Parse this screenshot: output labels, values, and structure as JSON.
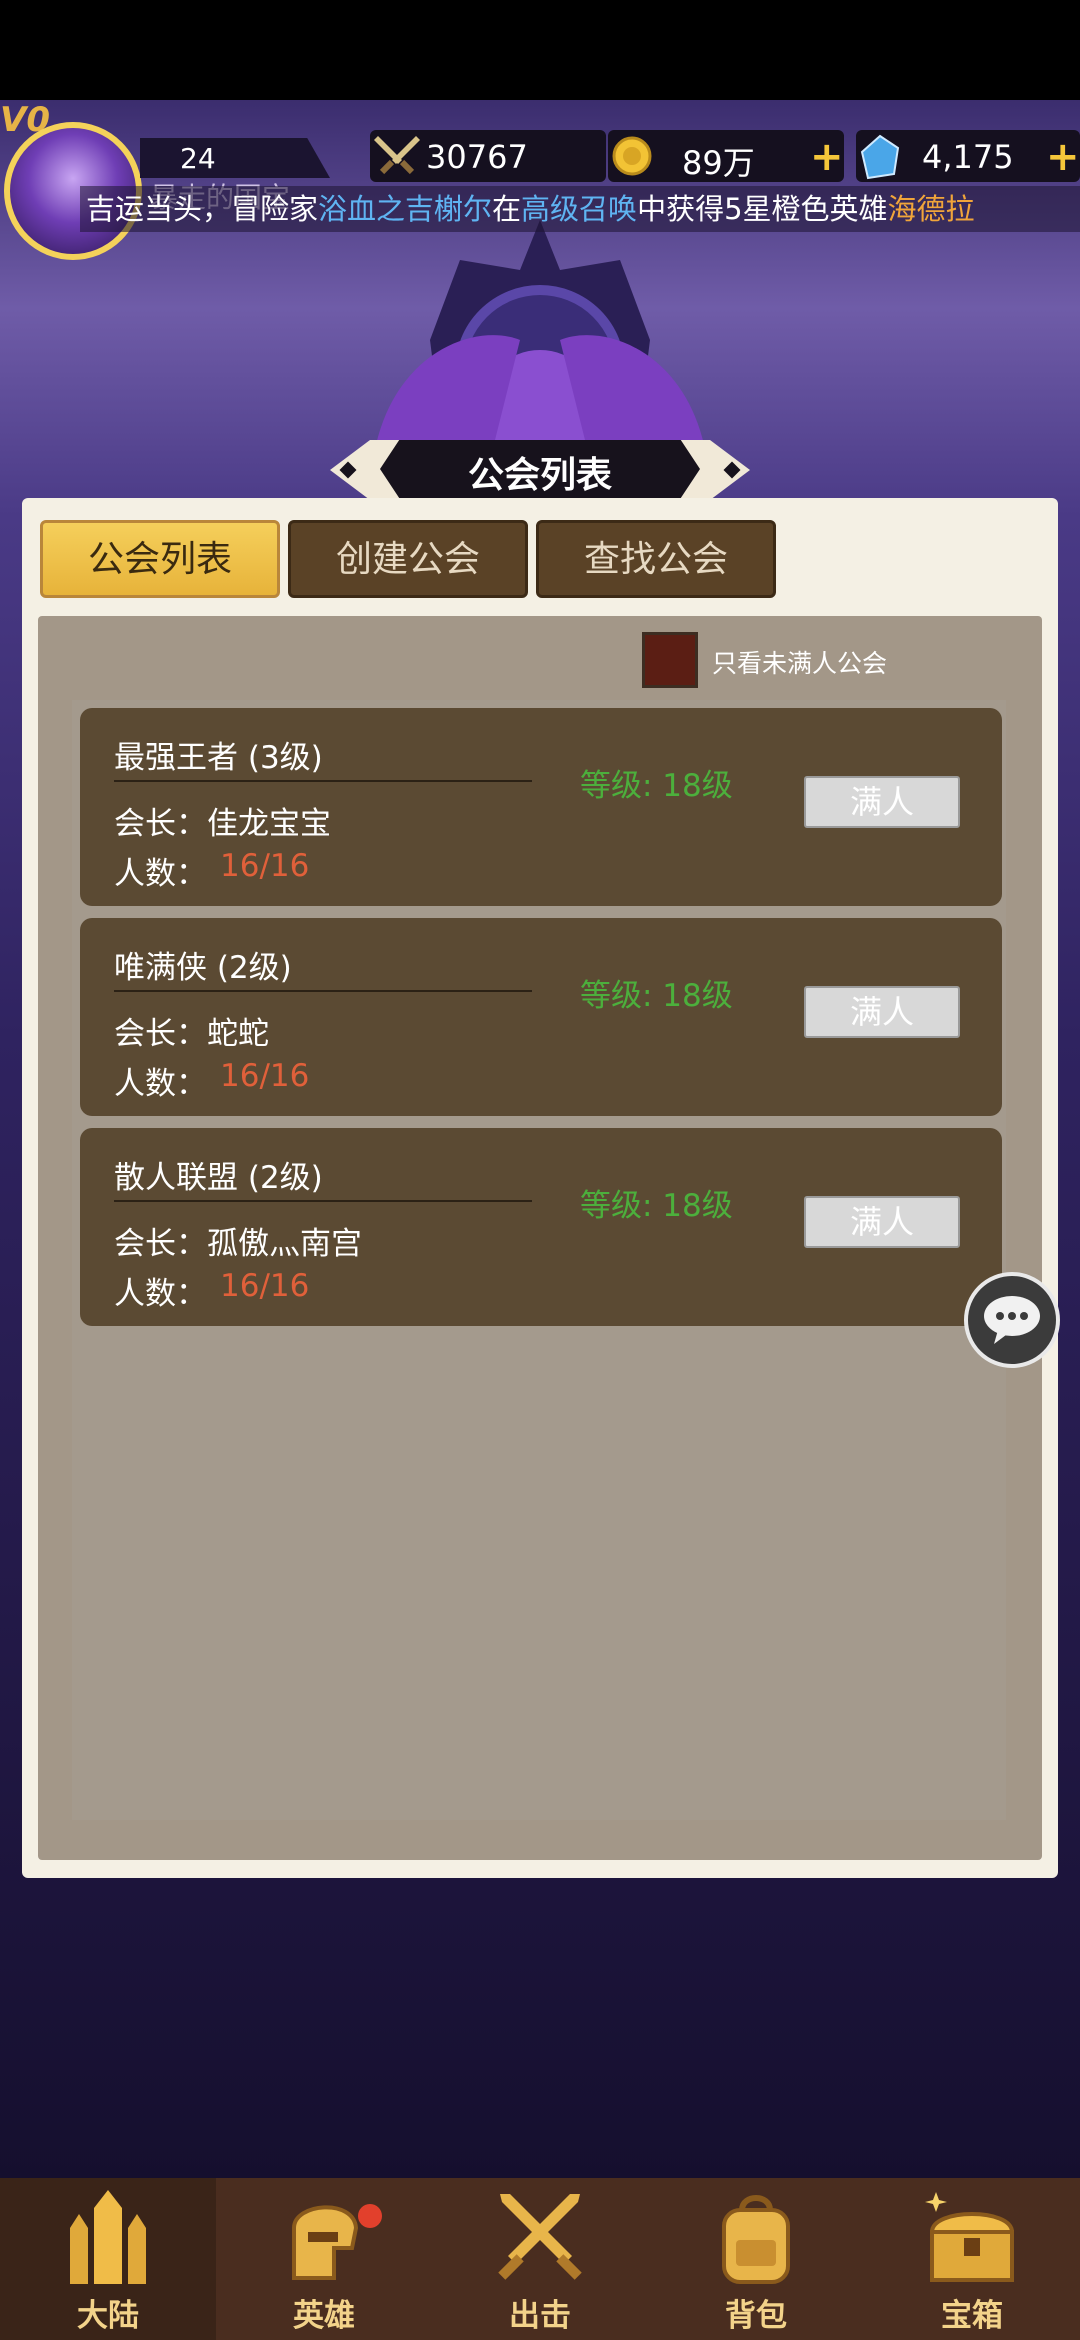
{
  "header": {
    "vip": "V0",
    "level": "24",
    "power": "30767",
    "gold": "89万",
    "gems": "4,175",
    "plus": "+",
    "under_ticker": "暴走的国宝"
  },
  "ticker": {
    "p1": "吉运当头，冒险家",
    "player": "浴血之吉榭尔",
    "p2": "在",
    "source": "高级召唤",
    "p3": "中获得5星橙色英雄",
    "hero": "海德拉"
  },
  "title": "公会列表",
  "tabs": [
    {
      "label": "公会列表",
      "active": true
    },
    {
      "label": "创建公会",
      "active": false
    },
    {
      "label": "查找公会",
      "active": false
    }
  ],
  "filter": {
    "label": "只看未满人公会"
  },
  "guilds": [
    {
      "name": "最强王者 (3级)",
      "leader": "会长：佳龙宝宝",
      "count_label": "人数：",
      "count": "16/16",
      "level": "等级: 18级",
      "status": "满人"
    },
    {
      "name": "唯满侠 (2级)",
      "leader": "会长：蛇蛇",
      "count_label": "人数：",
      "count": "16/16",
      "level": "等级: 18级",
      "status": "满人"
    },
    {
      "name": "散人联盟 (2级)",
      "leader": "会长：孤傲灬南宫",
      "count_label": "人数：",
      "count": "16/16",
      "level": "等级: 18级",
      "status": "满人"
    }
  ],
  "nav": [
    {
      "label": "大陆",
      "icon": "castle-icon"
    },
    {
      "label": "英雄",
      "icon": "helmet-icon"
    },
    {
      "label": "出击",
      "icon": "crossed-swords-icon"
    },
    {
      "label": "背包",
      "icon": "backpack-icon"
    },
    {
      "label": "宝箱",
      "icon": "treasure-chest-icon"
    }
  ],
  "colors": {
    "accent_gold": "#f5cf5b",
    "card_bg": "#5b4a33",
    "level_green": "#4caf3c",
    "count_orange": "#e0603a",
    "ticker_blue": "#5fb4f2",
    "ticker_orange": "#f1a53a"
  }
}
